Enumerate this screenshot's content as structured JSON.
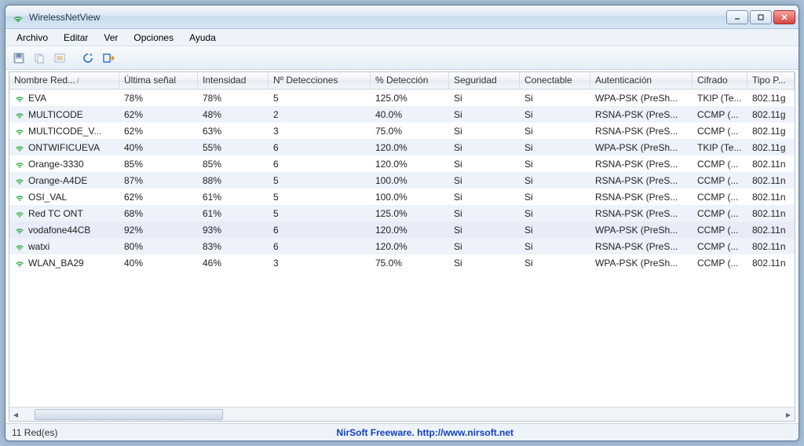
{
  "window": {
    "title": "WirelessNetView"
  },
  "menu": {
    "items": [
      "Archivo",
      "Editar",
      "Ver",
      "Opciones",
      "Ayuda"
    ]
  },
  "toolbar": {
    "buttons": [
      "save-icon",
      "copy-icon",
      "properties-icon",
      "refresh-icon",
      "exit-icon"
    ]
  },
  "columns": [
    "Nombre Red...",
    "Última señal",
    "Intensidad",
    "Nº Detecciones",
    "% Detección",
    "Seguridad",
    "Conectable",
    "Autenticación",
    "Cifrado",
    "Tipo P..."
  ],
  "sort_indicator": "/",
  "rows": [
    {
      "alt": false,
      "cells": [
        "EVA",
        "78%",
        "78%",
        "5",
        "125.0%",
        "Si",
        "Si",
        "WPA-PSK (PreSh...",
        "TKIP (Te...",
        "802.11g"
      ]
    },
    {
      "alt": true,
      "cells": [
        "MULTICODE",
        "62%",
        "48%",
        "2",
        "40.0%",
        "Si",
        "Si",
        "RSNA-PSK (PreS...",
        "CCMP (...",
        "802.11g"
      ]
    },
    {
      "alt": false,
      "cells": [
        "MULTICODE_V...",
        "62%",
        "63%",
        "3",
        "75.0%",
        "Si",
        "Si",
        "RSNA-PSK (PreS...",
        "CCMP (...",
        "802.11g"
      ]
    },
    {
      "alt": true,
      "cells": [
        "ONTWIFICUEVA",
        "40%",
        "55%",
        "6",
        "120.0%",
        "Si",
        "Si",
        "WPA-PSK (PreSh...",
        "TKIP (Te...",
        "802.11g"
      ]
    },
    {
      "alt": false,
      "cells": [
        "Orange-3330",
        "85%",
        "85%",
        "6",
        "120.0%",
        "Si",
        "Si",
        "RSNA-PSK (PreS...",
        "CCMP (...",
        "802.11n"
      ]
    },
    {
      "alt": true,
      "cells": [
        "Orange-A4DE",
        "87%",
        "88%",
        "5",
        "100.0%",
        "Si",
        "Si",
        "RSNA-PSK (PreS...",
        "CCMP (...",
        "802.11n"
      ]
    },
    {
      "alt": false,
      "cells": [
        "OSI_VAL",
        "62%",
        "61%",
        "5",
        "100.0%",
        "Si",
        "Si",
        "RSNA-PSK (PreS...",
        "CCMP (...",
        "802.11n"
      ]
    },
    {
      "alt": true,
      "cells": [
        "Red TC ONT",
        "68%",
        "61%",
        "5",
        "125.0%",
        "Si",
        "Si",
        "RSNA-PSK (PreS...",
        "CCMP (...",
        "802.11n"
      ]
    },
    {
      "alt": false,
      "sel": true,
      "cells": [
        "vodafone44CB",
        "92%",
        "93%",
        "6",
        "120.0%",
        "Si",
        "Si",
        "WPA-PSK (PreSh...",
        "CCMP (...",
        "802.11n"
      ]
    },
    {
      "alt": true,
      "cells": [
        "watxi",
        "80%",
        "83%",
        "6",
        "120.0%",
        "Si",
        "Si",
        "RSNA-PSK (PreS...",
        "CCMP (...",
        "802.11n"
      ]
    },
    {
      "alt": false,
      "cells": [
        "WLAN_BA29",
        "40%",
        "46%",
        "3",
        "75.0%",
        "Si",
        "Si",
        "WPA-PSK (PreSh...",
        "CCMP (...",
        "802.11n"
      ]
    }
  ],
  "status": {
    "count_label": "11 Red(es)",
    "credit_text": "NirSoft Freeware.  http://www.nirsoft.net"
  },
  "colors": {
    "wifi_icon": "#2aa83a"
  }
}
